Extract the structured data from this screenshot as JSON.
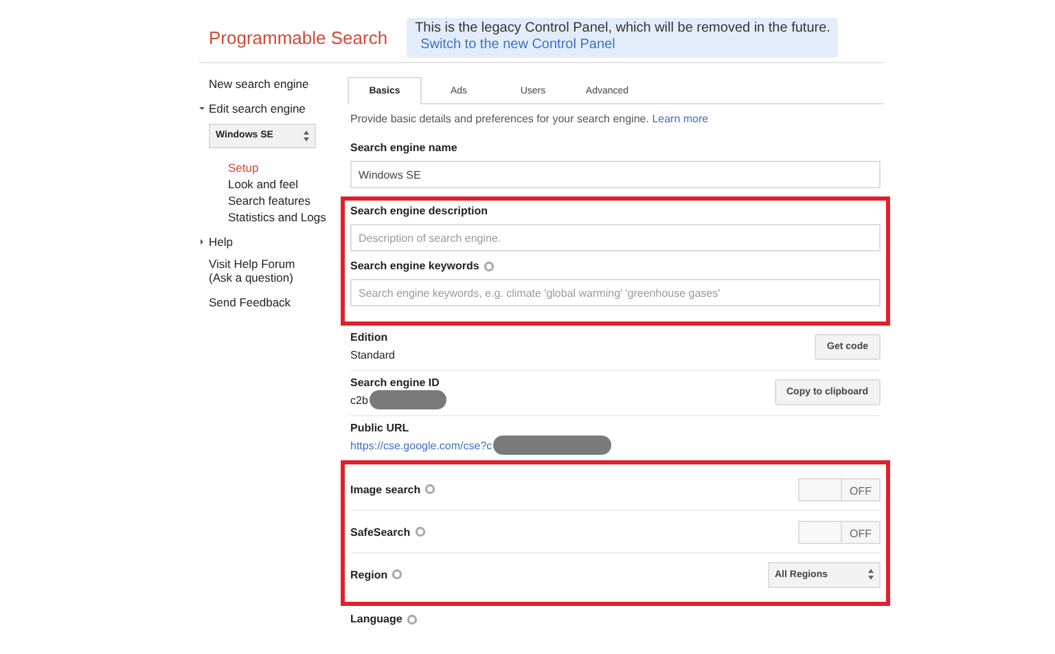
{
  "header": {
    "title": "Programmable Search",
    "notice": "This is the legacy Control Panel, which will be removed in the future.",
    "notice_link": "Switch to the new Control Panel"
  },
  "sidebar": {
    "new_engine": "New search engine",
    "edit_section": {
      "label": "Edit search engine",
      "expanded": true,
      "engine_select": "Windows SE",
      "items": [
        {
          "label": "Setup",
          "selected": true
        },
        {
          "label": "Look and feel",
          "selected": false
        },
        {
          "label": "Search features",
          "selected": false
        },
        {
          "label": "Statistics and Logs",
          "selected": false
        }
      ]
    },
    "help": {
      "label": "Help",
      "expanded": false
    },
    "links": [
      "Visit Help Forum (Ask a question)",
      "Send Feedback"
    ]
  },
  "tabs": [
    {
      "label": "Basics",
      "selected": true
    },
    {
      "label": "Ads",
      "selected": false
    },
    {
      "label": "Users",
      "selected": false
    },
    {
      "label": "Advanced",
      "selected": false
    }
  ],
  "intro": {
    "text": "Provide basic details and preferences for your search engine.",
    "link": "Learn more"
  },
  "sections": [
    {
      "highlighted": false,
      "fields": [
        {
          "kind": "input",
          "label": "Search engine name",
          "help": false,
          "value": "Windows SE"
        }
      ]
    },
    {
      "highlighted": true,
      "fields": [
        {
          "kind": "input",
          "label": "Search engine description",
          "help": false,
          "placeholder": "Description of search engine."
        },
        {
          "kind": "input",
          "label": "Search engine keywords",
          "help": true,
          "placeholder": "Search engine keywords, e.g. climate 'global warming' 'greenhouse gases'"
        }
      ]
    },
    {
      "highlighted": false,
      "fields": [
        {
          "kind": "info",
          "label": "Edition",
          "value": "Standard",
          "redacted": false,
          "button": "Get code"
        },
        {
          "kind": "info",
          "label": "Search engine ID",
          "value": "c2b",
          "redacted": true,
          "button": "Copy to clipboard"
        },
        {
          "kind": "link",
          "label": "Public URL",
          "value": "https://cse.google.com/cse?c",
          "redacted": true
        }
      ]
    },
    {
      "highlighted": true,
      "fields": [
        {
          "kind": "toggle",
          "label": "Image search",
          "help": true,
          "on": false,
          "state_label": "OFF"
        },
        {
          "kind": "toggle",
          "label": "SafeSearch",
          "help": true,
          "on": false,
          "state_label": "OFF"
        },
        {
          "kind": "select",
          "label": "Region",
          "help": true,
          "value": "All Regions"
        }
      ]
    },
    {
      "highlighted": false,
      "fields": [
        {
          "kind": "heading",
          "label": "Language",
          "help": true
        }
      ]
    }
  ]
}
